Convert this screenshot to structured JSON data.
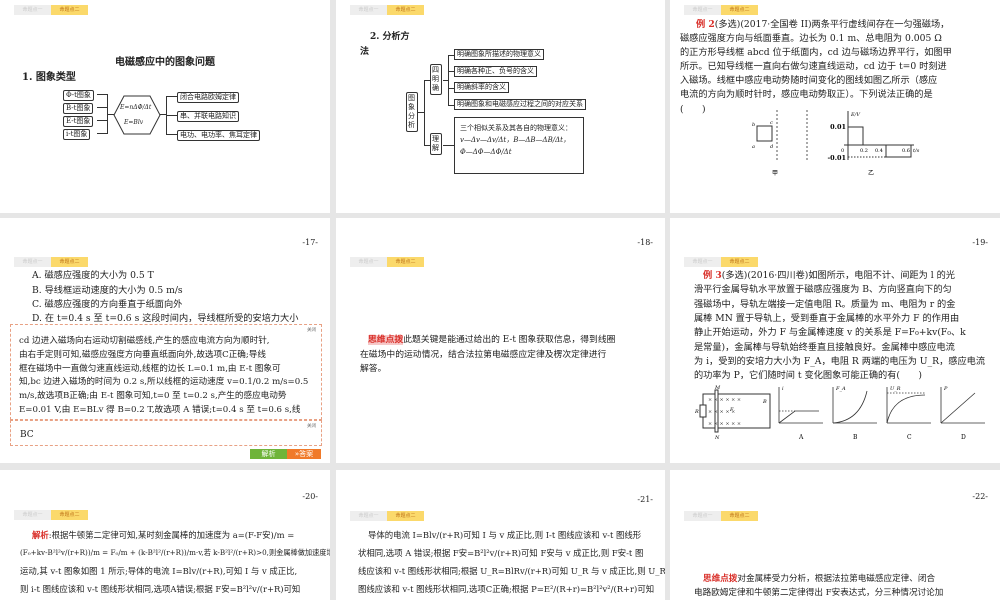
{
  "tabs": {
    "t1": "命题点一",
    "t2": "命题点二"
  },
  "s1": {
    "title": "电磁感应中的图象问题",
    "heading": "1. 图象类型",
    "left": [
      "Φ-t图象",
      "B-t图象",
      "E-t图象",
      "i-t图象"
    ],
    "hex": [
      "E=nΔΦ/Δt",
      "E=Blv"
    ],
    "right": [
      "闭合电路欧姆定律",
      "串、并联电路知识",
      "电功、电功率、焦耳定律"
    ]
  },
  "s2": {
    "heading1": "2. 分析方",
    "heading2": "法",
    "root": "图象分析",
    "b1": "四明确",
    "b2": "理解",
    "items": [
      "明确图象所描述的物理意义",
      "明确各种正、负号的含义",
      "明确斜率的含义",
      "明确图象和电磁感应过程之间的对应关系"
    ],
    "understand": [
      "三个相似关系及其各自的物理意义：",
      "v—Δv—Δv/Δt，B—ΔB—ΔB/Δt，",
      "Φ—ΔΦ—ΔΦ/Δt"
    ]
  },
  "s3": {
    "label": "例 2",
    "lines": [
      "(多选)(2017·全国卷 II)两条平行虚线间存在一匀强磁场，",
      "磁感应强度方向与纸面垂直。边长为 0.1 m、总电阻为 0.005 Ω",
      "的正方形导线框 abcd 位于纸面内，cd 边与磁场边界平行，如图甲",
      "所示。已知导线框一直向右做匀速直线运动，cd 边于 t=0 时刻进",
      "入磁场。线框中感应电动势随时间变化的图线如图乙所示（感应",
      "电流的方向为顺时针时，感应电动势取正）。下列说法正确的是",
      "(　　)"
    ],
    "fig_a": "甲",
    "fig_b": "乙",
    "corners": [
      "b",
      "c",
      "a",
      "d"
    ],
    "ylabel": "E/V",
    "xlabel": "t/s",
    "yticks": [
      "0.01",
      "-0.01"
    ],
    "xticks": [
      "0",
      "0.2",
      "0.4",
      "0.6"
    ]
  },
  "s4": {
    "page": "-17-",
    "options": [
      "A. 磁感应强度的大小为 0.5 T",
      "B. 导线框运动速度的大小为 0.5 m/s",
      "C. 磁感应强度的方向垂直于纸面向外",
      "D. 在 t=0.4 s 至 t=0.6 s 这段时间内，导线框所受的安培力大小"
    ],
    "close": "关闭",
    "analysis": [
      "cd 边进入磁场向右运动切割磁感线,产生的感应电流方向为顺时针,",
      "由右手定则可知,磁感应强度方向垂直纸面向外,故选项C正确;导线",
      "框在磁场中一直做匀速直线运动,线框的边长 L=0.1 m,由 E-t 图象可",
      "知,bc 边进入磁场的时间为 0.2 s,所以线框的运动速度 v=0.1/0.2 m/s=0.5",
      "m/s,故选项B正确;由 E-t 图象可知,t=0 至 t=0.2 s,产生的感应电动势",
      "E=0.01 V,由 E=BLv 得 B=0.2 T,故选项 A 错误;t=0.4 s 至 t=0.6 s,线"
    ],
    "answer": "BC",
    "btn_analysis": "解析",
    "btn_answer": "答案"
  },
  "s5": {
    "page": "-18-",
    "label": "思维点拨",
    "lines": [
      "此题关键是能通过给出的 E-t 图象获取信息，得到线圈",
      "在磁场中的运动情况，结合法拉第电磁感应定律及楞次定律进行",
      "解答。"
    ]
  },
  "s6": {
    "page": "-19-",
    "label": "例 3",
    "lines": [
      "(多选)(2016·四川卷)如图所示，电阻不计、间距为 l 的光",
      "滑平行金属导轨水平放置于磁感应强度为 B、方向竖直向下的匀",
      "强磁场中，导轨左端接一定值电阻 R。质量为 m、电阻为 r 的金",
      "属棒 MN 置于导轨上，受到垂直于金属棒的水平外力 F 的作用由",
      "静止开始运动，外力 F 与金属棒速度 v 的关系是 F=F₀+kv(F₀、k",
      "是常量)，金属棒与导轨始终垂直且接触良好。金属棒中感应电流",
      "为 i，受到的安培力大小为 F_A，电阻 R 两端的电压为 U_R，感应电流",
      "的功率为 P，它们随时间 t 变化图象可能正确的有(　　)"
    ],
    "graphs": [
      "A",
      "B",
      "C",
      "D"
    ],
    "gy": [
      "i",
      "F_A",
      "U_R",
      "P"
    ],
    "circuit": [
      "M",
      "N",
      "R",
      "B",
      "F"
    ]
  },
  "s7": {
    "page": "-20-",
    "label": "解析",
    "lines": [
      ":根据牛顿第二定律可知,某时刻金属棒的加速度为 a=(F-F安)/m =",
      "(F₀+kv-B²l²v/(r+R))/m = F₀/m + (k-B²l²/(r+R))/m·v,若 k-B²l²/(r+R)>0,则金属棒做加速度增加的加速",
      "运动,其 v-t 图象如图 1 所示;导体的电流 I=Blv/(r+R),可知 I 与 v 成正比,",
      "则 i-t 图线应该和 v-t 图线形状相同,选项A错误;根据 F安=B²l²v/(r+R)可知"
    ]
  },
  "s8": {
    "page": "-21-",
    "lines": [
      "导体的电流 I=Blv/(r+R)可知 I 与 v 成正比,则 I-t 图线应该和 v-t 图线形",
      "状相同,选项 A 错误;根据 F安=B²l²v/(r+R)可知 F安与 v 成正比,则 F安-t 图",
      "线应该和 v-t 图线形状相同;根据 U_R=BlRv/(r+R)可知 U_R 与 v 成正比,则 U_R-t",
      "图线应该和 v-t 图线形状相同,选项C正确;根据 P=E²/(R+r)=B²l²v²/(R+r)可知"
    ]
  },
  "s9": {
    "page": "-22-",
    "label": "思维点拨",
    "lines": [
      "对金属棒受力分析，根据法拉第电磁感应定律、闭合",
      "电路欧姆定律和牛顿第二定律得出 F安表达式，分三种情况讨论加"
    ]
  }
}
